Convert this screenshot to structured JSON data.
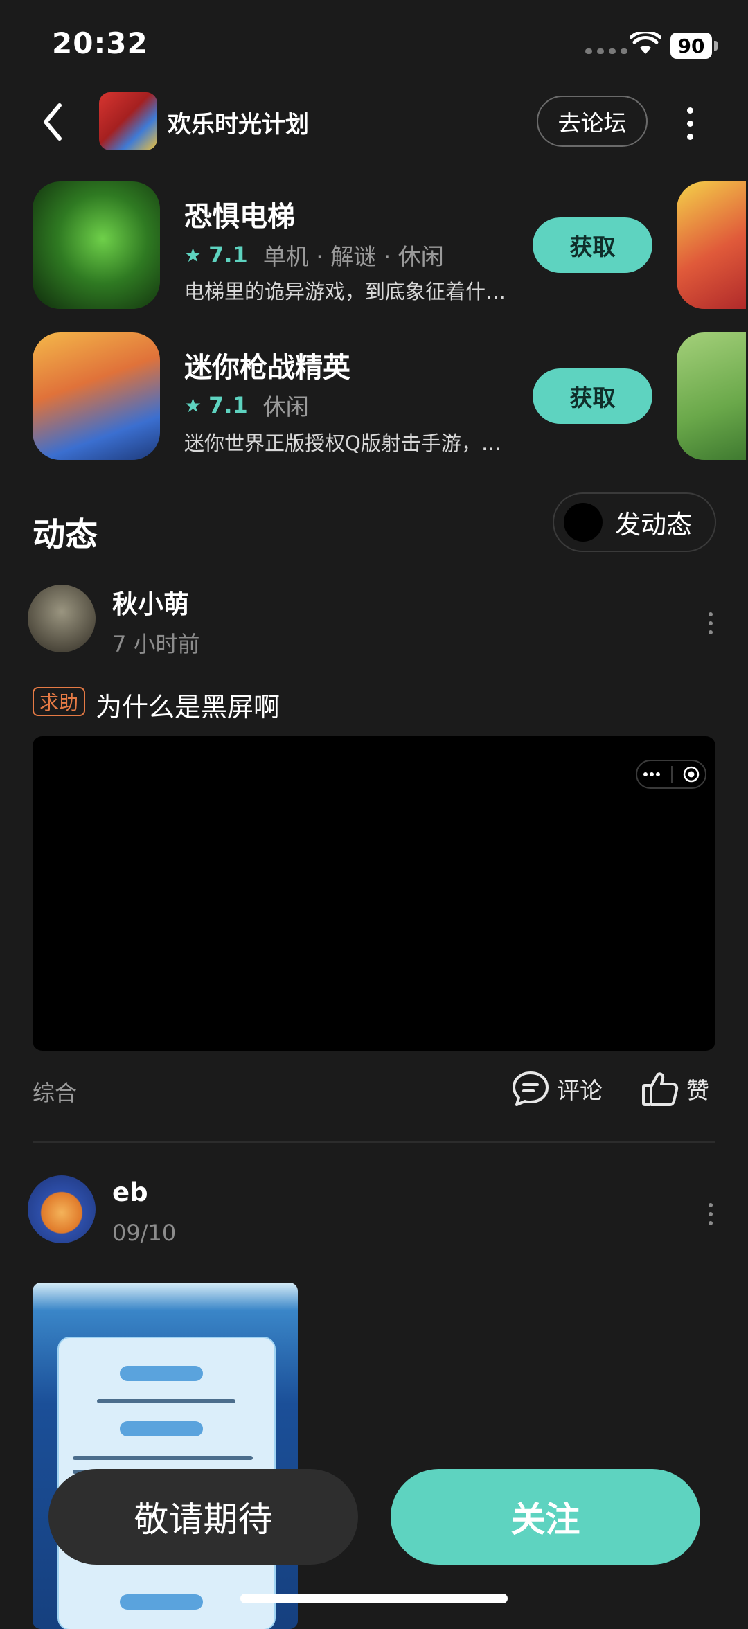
{
  "status_bar": {
    "time": "20:32",
    "battery": "90"
  },
  "header": {
    "title": "欢乐时光计划",
    "forum_button": "去论坛"
  },
  "games": [
    {
      "name": "恐惧电梯",
      "rating": "7.1",
      "tags": "单机 · 解谜 · 休闲",
      "description": "电梯里的诡异游戏，到底象征着什么？",
      "get_label": "获取"
    },
    {
      "name": "迷你枪战精英",
      "rating": "7.1",
      "tags": "休闲",
      "description": "迷你世界正版授权Q版射击手游，精英集结",
      "get_label": "获取"
    }
  ],
  "feed": {
    "section_title": "动态",
    "post_button": "发动态"
  },
  "posts": [
    {
      "user": "秋小萌",
      "time": "7 小时前",
      "tag": "求助",
      "text": "为什么是黑屏啊",
      "category": "综合",
      "comment_label": "评论",
      "like_label": "赞"
    },
    {
      "user": "eb",
      "time": "09/10"
    }
  ],
  "bottom": {
    "stay_button": "敬请期待",
    "follow_button": "关注"
  },
  "colors": {
    "accent": "#5ed3c0",
    "background": "#1b1b1b",
    "tag": "#e57a45"
  }
}
